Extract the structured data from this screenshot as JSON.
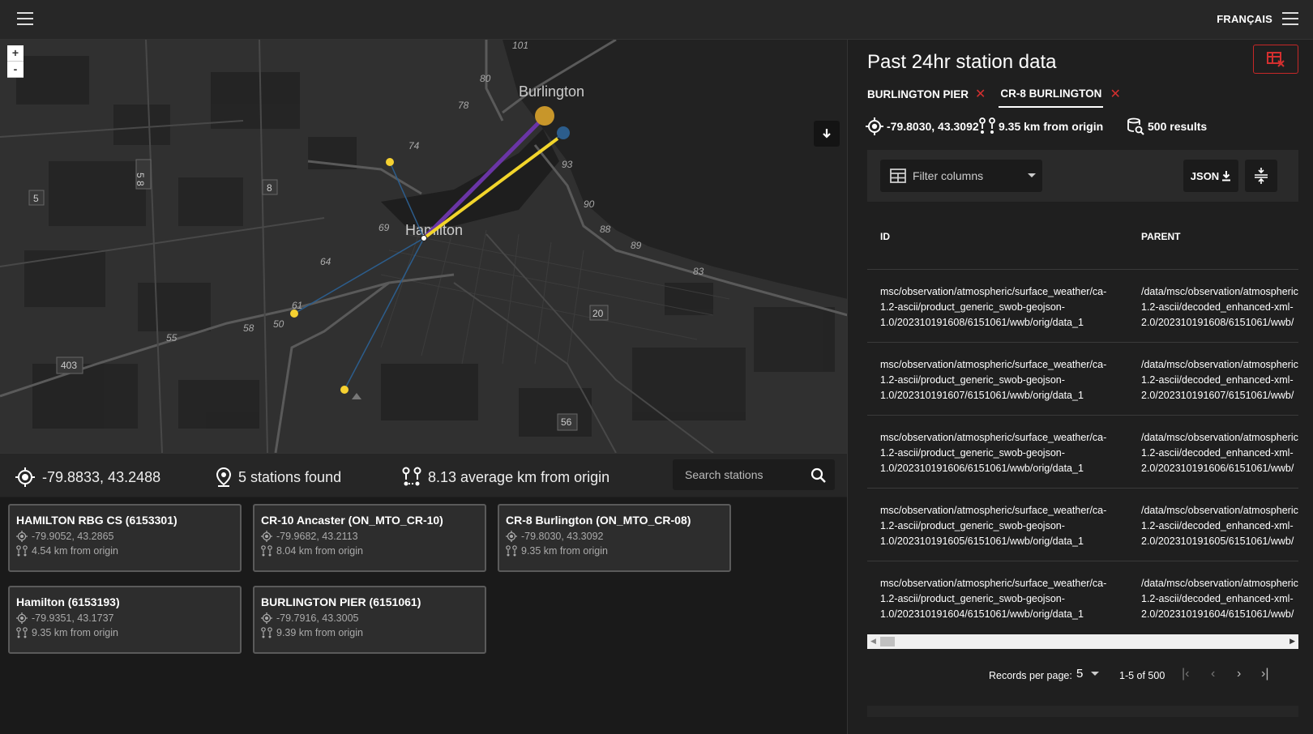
{
  "topbar": {
    "lang": "FRANÇAIS"
  },
  "map": {
    "zoom_in": "+",
    "zoom_out": "-",
    "labels": {
      "burlington": "Burlington",
      "hamilton": "Hamilton",
      "r403": "403",
      "r5": "5",
      "r58": "5 8",
      "r8": "8",
      "r20": "20",
      "r56": "56",
      "n101": "101",
      "n80": "80",
      "n78": "78",
      "n74": "74",
      "n93": "93",
      "n90": "90",
      "n88": "88",
      "n89": "89",
      "n83": "83",
      "n69": "69",
      "n64": "64",
      "n61": "61",
      "n55": "55",
      "n58b": "58",
      "n50": "50"
    },
    "colors": {
      "purple": "#6a35a6",
      "yellow": "#f2d52b",
      "gold": "#c8962a",
      "blue": "#2c5d8c",
      "station": "#f5d131"
    }
  },
  "infobar": {
    "coords": "-79.8833, 43.2488",
    "stations": "5 stations found",
    "avg": "8.13 average km from origin",
    "search_placeholder": "Search stations"
  },
  "stations": [
    {
      "name": "HAMILTON RBG CS (6153301)",
      "coords": "-79.9052, 43.2865",
      "dist": "4.54 km from origin"
    },
    {
      "name": "CR-10 Ancaster (ON_MTO_CR-10)",
      "coords": "-79.9682, 43.2113",
      "dist": "8.04 km from origin"
    },
    {
      "name": "CR-8 Burlington (ON_MTO_CR-08)",
      "coords": "-79.8030, 43.3092",
      "dist": "9.35 km from origin"
    },
    {
      "name": "Hamilton (6153193)",
      "coords": "-79.9351, 43.1737",
      "dist": "9.35 km from origin"
    },
    {
      "name": "BURLINGTON PIER (6151061)",
      "coords": "-79.7916, 43.3005",
      "dist": "9.39 km from origin"
    }
  ],
  "panel": {
    "title": "Past 24hr station data",
    "tabs": [
      {
        "label": "BURLINGTON PIER",
        "close": "✕"
      },
      {
        "label": "CR-8 BURLINGTON",
        "close": "✕"
      }
    ],
    "coords": "-79.8030, 43.3092",
    "dist": "9.35 km from origin",
    "results": "500 results",
    "filter_label": "Filter columns",
    "json_label": "JSON",
    "columns": {
      "id": "ID",
      "parent": "PARENT"
    },
    "rows": [
      {
        "id": [
          "msc/observation/atmospheric/surface_weather/ca-",
          "1.2-ascii/product_generic_swob-geojson-",
          "1.0/202310191608/6151061/wwb/orig/data_1"
        ],
        "parent": [
          "/data/msc/observation/atmospheric/",
          "1.2-ascii/decoded_enhanced-xml-",
          "2.0/202310191608/6151061/wwb/"
        ]
      },
      {
        "id": [
          "msc/observation/atmospheric/surface_weather/ca-",
          "1.2-ascii/product_generic_swob-geojson-",
          "1.0/202310191607/6151061/wwb/orig/data_1"
        ],
        "parent": [
          "/data/msc/observation/atmospheric/",
          "1.2-ascii/decoded_enhanced-xml-",
          "2.0/202310191607/6151061/wwb/"
        ]
      },
      {
        "id": [
          "msc/observation/atmospheric/surface_weather/ca-",
          "1.2-ascii/product_generic_swob-geojson-",
          "1.0/202310191606/6151061/wwb/orig/data_1"
        ],
        "parent": [
          "/data/msc/observation/atmospheric/",
          "1.2-ascii/decoded_enhanced-xml-",
          "2.0/202310191606/6151061/wwb/"
        ]
      },
      {
        "id": [
          "msc/observation/atmospheric/surface_weather/ca-",
          "1.2-ascii/product_generic_swob-geojson-",
          "1.0/202310191605/6151061/wwb/orig/data_1"
        ],
        "parent": [
          "/data/msc/observation/atmospheric/",
          "1.2-ascii/decoded_enhanced-xml-",
          "2.0/202310191605/6151061/wwb/"
        ]
      },
      {
        "id": [
          "msc/observation/atmospheric/surface_weather/ca-",
          "1.2-ascii/product_generic_swob-geojson-",
          "1.0/202310191604/6151061/wwb/orig/data_1"
        ],
        "parent": [
          "/data/msc/observation/atmospheric/",
          "1.2-ascii/decoded_enhanced-xml-",
          "2.0/202310191604/6151061/wwb/"
        ]
      }
    ],
    "pager": {
      "label": "Records per page:",
      "per_page": "5",
      "range": "1-5 of 500",
      "first": "|‹",
      "prev": "‹",
      "next": "›",
      "last": "›|"
    }
  }
}
